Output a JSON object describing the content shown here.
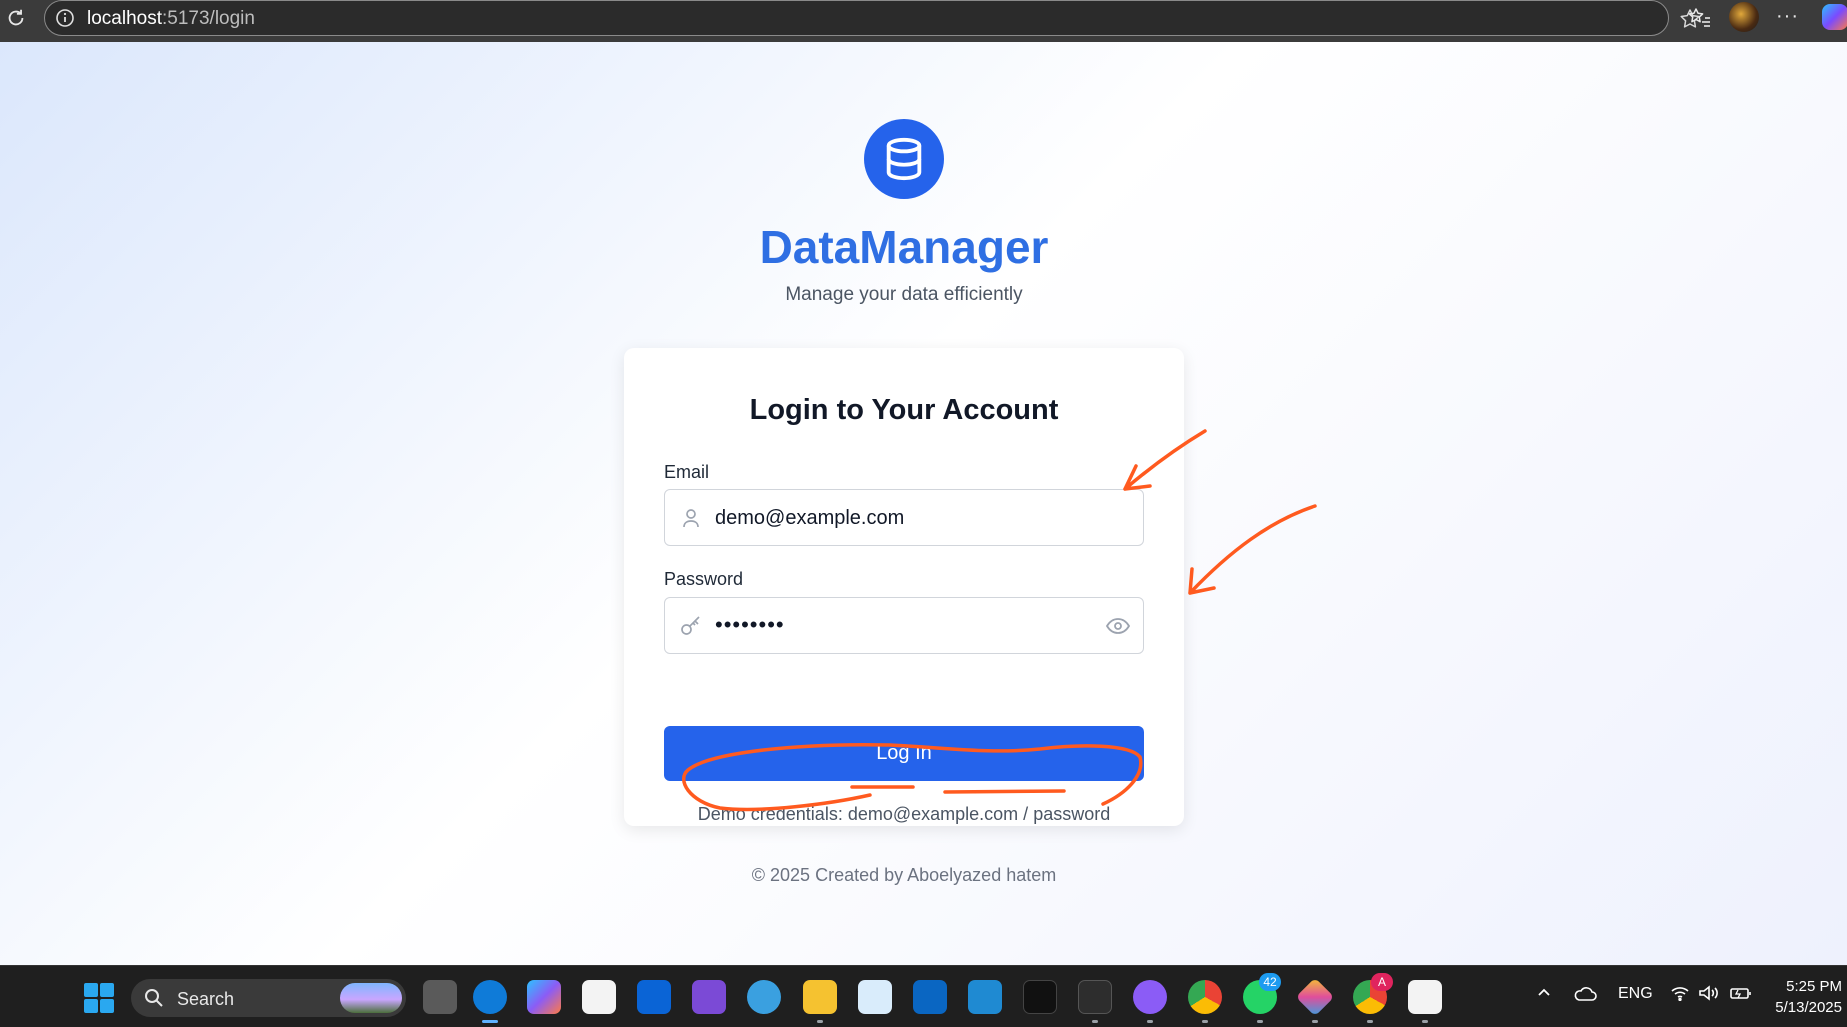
{
  "browser": {
    "url_host": "localhost",
    "url_path": ":5173/login",
    "more_label": "···"
  },
  "brand": {
    "title": "DataManager",
    "tagline": "Manage your data efficiently",
    "accent": "#2563eb",
    "logo_icon": "database-icon"
  },
  "login_card": {
    "title": "Login to Your Account",
    "email_label": "Email",
    "email_value": "demo@example.com",
    "password_label": "Password",
    "password_value": "••••••••",
    "submit_label": "Log In",
    "demo_prefix": "Demo credentials: ",
    "demo_email": "demo@example.com",
    "demo_separator": " / ",
    "demo_password": "password"
  },
  "footer": {
    "text": "© 2025 Created by Aboelyazed hatem"
  },
  "annotation_color": "#ff5a1f",
  "taskbar": {
    "search_label": "Search",
    "whatsapp_badge": "42",
    "chrome_profile_badge": "A",
    "language": "ENG",
    "time": "5:25 PM",
    "date": "5/13/2025"
  }
}
